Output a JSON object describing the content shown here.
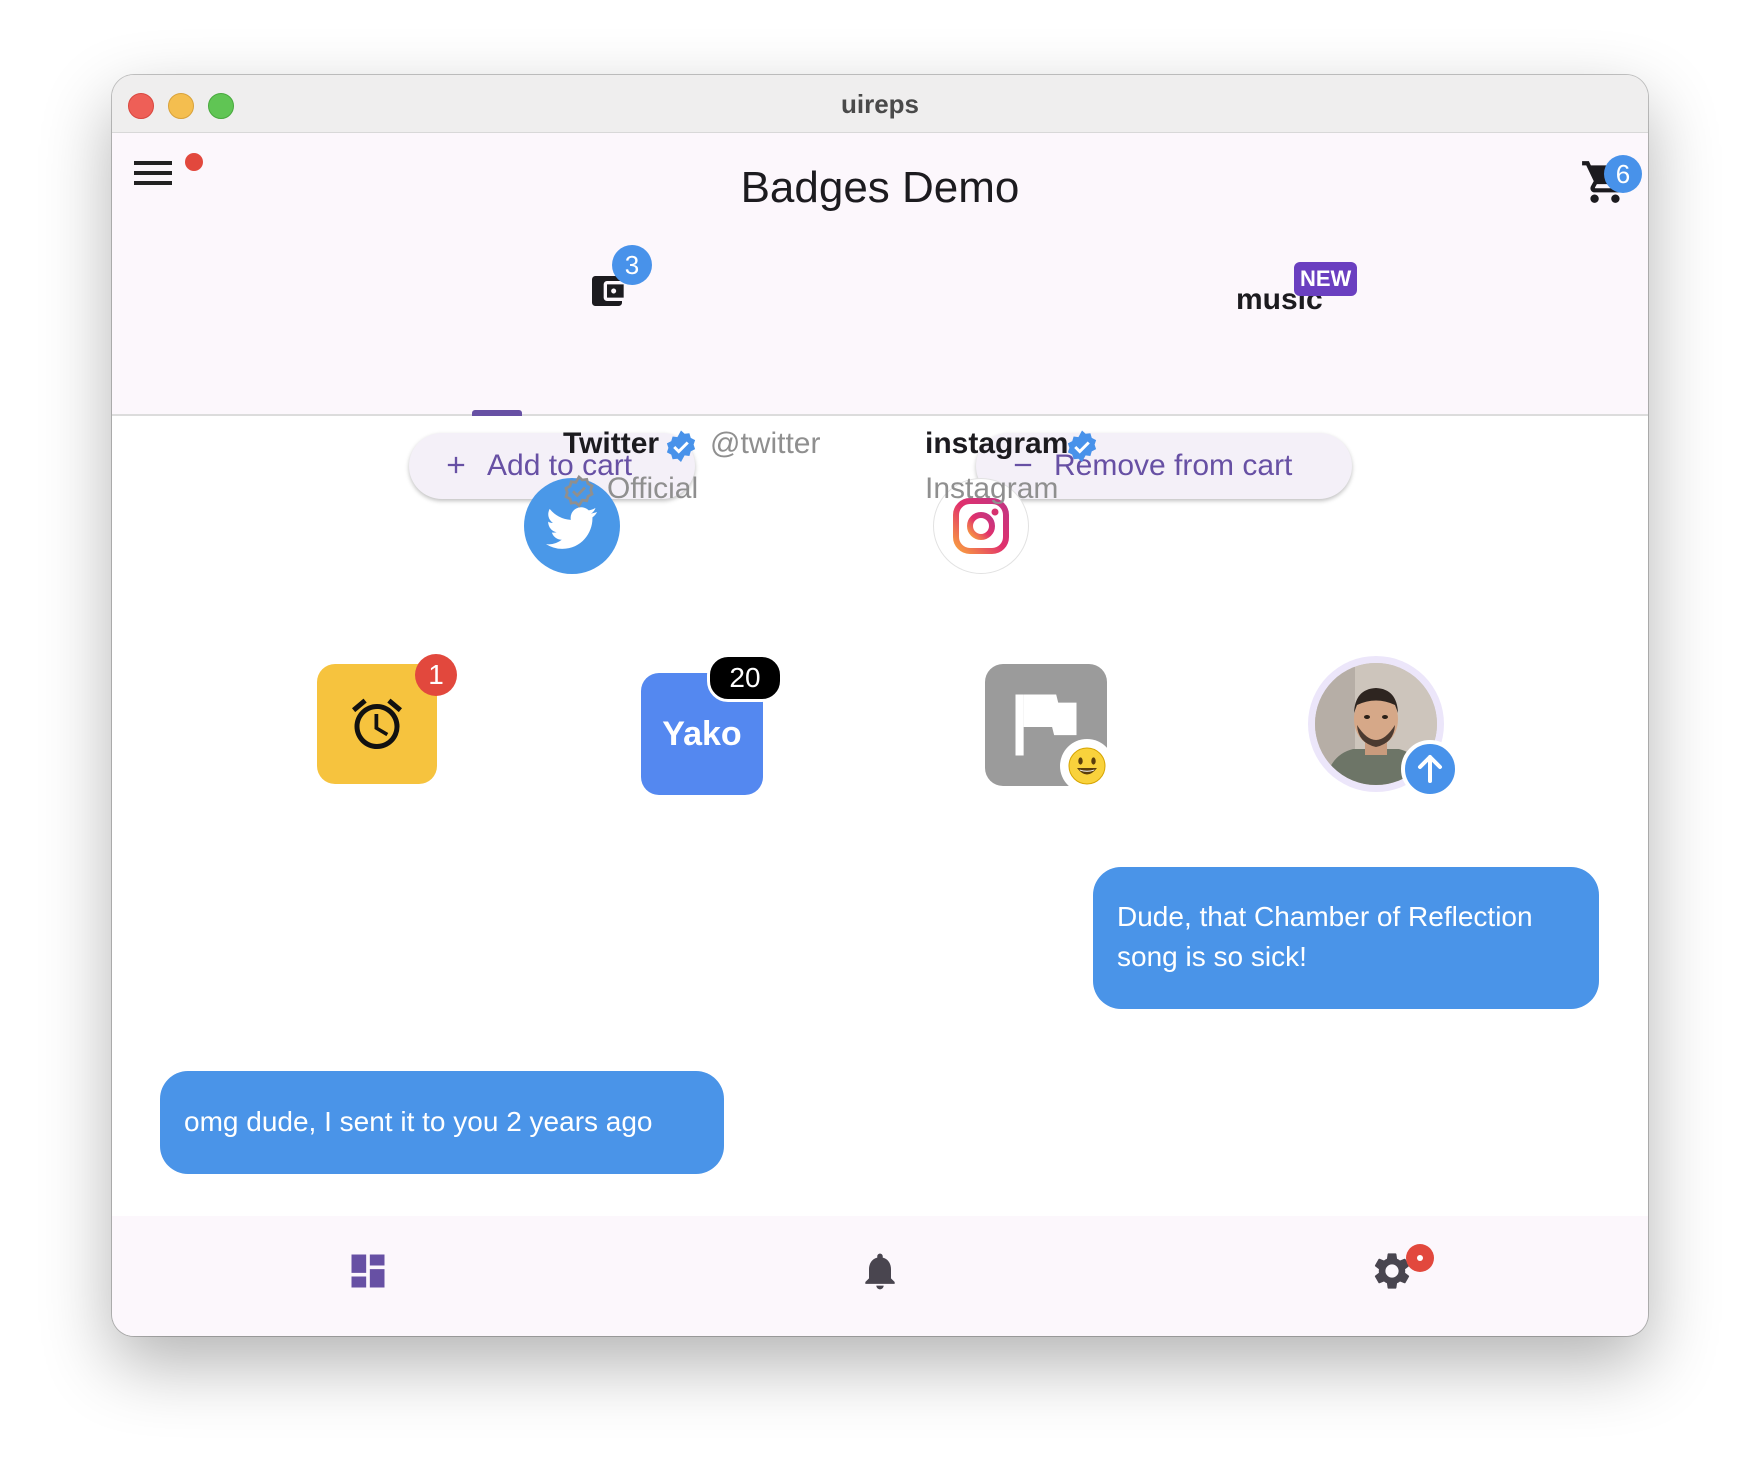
{
  "window": {
    "title": "uireps"
  },
  "appbar": {
    "title": "Badges Demo",
    "menu_icon": "hamburger-menu-icon",
    "cart_icon": "shopping-cart-icon",
    "cart_count": "6"
  },
  "tabs": [
    {
      "icon": "wallet-icon",
      "badge": "3",
      "selected": true
    },
    {
      "label": "music",
      "badge": "NEW",
      "selected": false
    }
  ],
  "actions": {
    "add_label": "Add to cart",
    "remove_label": "Remove from cart"
  },
  "social": [
    {
      "name": "Twitter",
      "handle": "@twitter",
      "subtitle": "Official",
      "verified": true
    },
    {
      "name": "instagram",
      "subtitle": "Instagram",
      "verified": true
    }
  ],
  "app_icons": [
    {
      "icon": "alarm-clock-icon",
      "badge": "1"
    },
    {
      "label": "Yako",
      "badge": "20"
    },
    {
      "icon": "flag-icon",
      "badge_icon": "smiley-emoji-icon"
    },
    {
      "icon": "avatar",
      "badge_icon": "arrow-up-icon"
    }
  ],
  "messages": [
    {
      "text": "Dude, that Chamber of Reflection song is so sick!",
      "side": "right"
    },
    {
      "text": "omg dude, I sent it to you 2 years ago",
      "side": "left"
    }
  ],
  "bottom_nav": [
    {
      "icon": "dashboard-icon",
      "selected": true
    },
    {
      "icon": "bell-icon",
      "selected": false
    },
    {
      "icon": "settings-gear-icon",
      "selected": false,
      "has_dot_badge": true
    }
  ],
  "colors": {
    "accent": "#6750a4",
    "badge_blue": "#4892ea",
    "badge_red": "#e2483d",
    "bubble": "#4a94e8",
    "twitter": "#4a98e8",
    "alarm_tile": "#f6c33e",
    "yako_tile": "#5488f0"
  }
}
